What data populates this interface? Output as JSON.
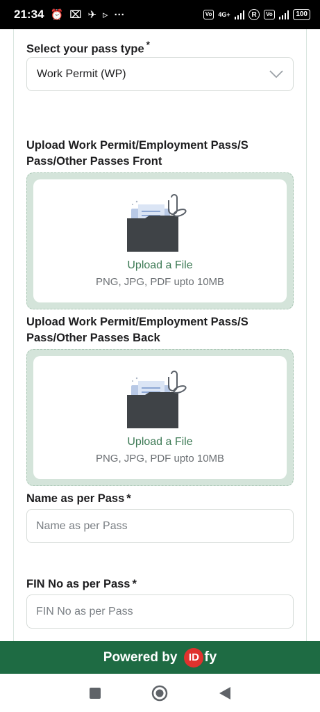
{
  "status_bar": {
    "time": "21:34",
    "network_label": "4G+",
    "chip_label": "Vo LTE",
    "r_label": "R",
    "battery": "100"
  },
  "form": {
    "pass_type": {
      "label": "Select your pass type",
      "required": "*",
      "selected": "Work Permit (WP)"
    },
    "upload_front": {
      "label": "Upload Work Permit/Employment Pass/S Pass/Other Passes Front",
      "title": "Upload a File",
      "hint": "PNG, JPG, PDF upto 10MB"
    },
    "upload_back": {
      "label": "Upload Work Permit/Employment Pass/S Pass/Other Passes Back",
      "title": "Upload a File",
      "hint": "PNG, JPG, PDF upto 10MB"
    },
    "name": {
      "label": "Name as per Pass",
      "required": "*",
      "placeholder": "Name as per Pass"
    },
    "fin": {
      "label": "FIN No as per Pass",
      "required": "*",
      "placeholder": "FIN No as per Pass"
    }
  },
  "footer": {
    "powered_by": "Powered by",
    "brand_id": "ID",
    "brand_fy": "fy"
  },
  "colors": {
    "accent": "#1e6b43",
    "upload_bg": "#d4e4da",
    "link_green": "#3d7a55",
    "brand_red": "#e0322e"
  }
}
